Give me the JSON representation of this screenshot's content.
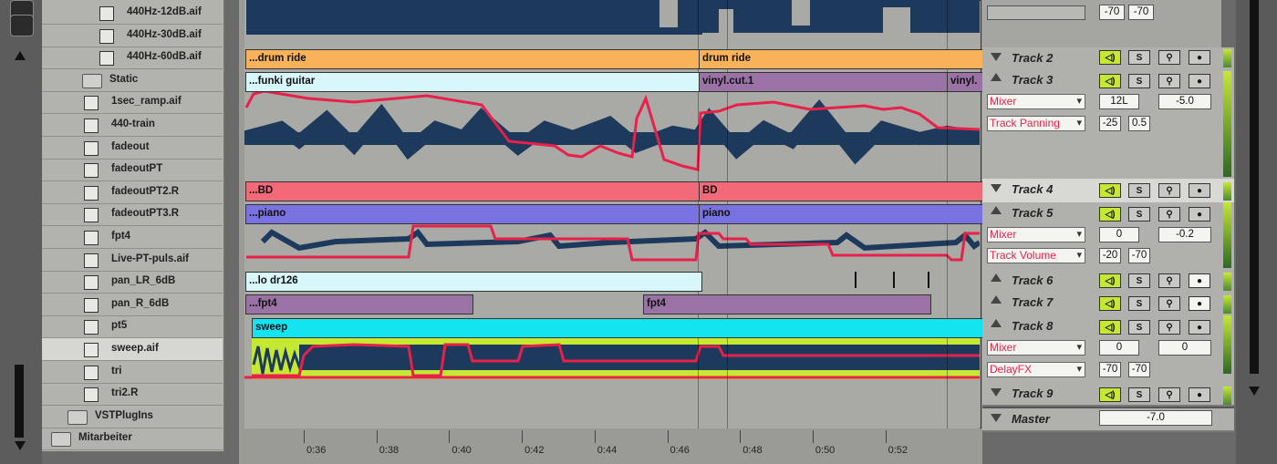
{
  "browser": {
    "items": [
      {
        "label": "440Hz-12dB.aif",
        "type": "file"
      },
      {
        "label": "440Hz-30dB.aif",
        "type": "file"
      },
      {
        "label": "440Hz-60dB.aif",
        "type": "file"
      },
      {
        "label": "Static",
        "type": "folder"
      },
      {
        "label": "1sec_ramp.aif",
        "type": "file"
      },
      {
        "label": "440-train",
        "type": "file"
      },
      {
        "label": "fadeout",
        "type": "file"
      },
      {
        "label": "fadeoutPT",
        "type": "file"
      },
      {
        "label": "fadeoutPT2.R",
        "type": "file"
      },
      {
        "label": "fadeoutPT3.R",
        "type": "file"
      },
      {
        "label": "fpt4",
        "type": "file"
      },
      {
        "label": "Live-PT-puls.aif",
        "type": "file"
      },
      {
        "label": "pan_LR_6dB",
        "type": "file"
      },
      {
        "label": "pan_R_6dB",
        "type": "file"
      },
      {
        "label": "pt5",
        "type": "file"
      },
      {
        "label": "sweep.aif",
        "type": "file"
      },
      {
        "label": "tri",
        "type": "file"
      },
      {
        "label": "tri2.R",
        "type": "file"
      },
      {
        "label": "VSTPlugIns",
        "type": "folder"
      },
      {
        "label": "Mitarbeiter",
        "type": "folder"
      }
    ],
    "selected": "sweep.aif"
  },
  "clips": {
    "drum_ride_a": "...drum ride",
    "drum_ride_b": "drum ride",
    "funki_guitar": "...funki guitar",
    "vinyl_cut": "vinyl.cut.1",
    "vinyl_short": "vinyl.",
    "bd_a": "...BD",
    "bd_b": "BD",
    "piano_a": "...piano",
    "piano_b": "piano",
    "lo_dr": "...lo dr126",
    "fpt4_a": "...fpt4",
    "fpt4_b": "fpt4",
    "sweep": "sweep"
  },
  "timeline": {
    "ticks": [
      "0:36",
      "0:38",
      "0:40",
      "0:42",
      "0:44",
      "0:46",
      "0:48",
      "0:50",
      "0:52"
    ]
  },
  "tracks": {
    "track1": {
      "num_a": "-70",
      "num_b": "-70"
    },
    "track2": {
      "name": "Track 2"
    },
    "track3": {
      "name": "Track 3",
      "dd1": "Mixer",
      "dd2": "Track Panning",
      "v1": "12L",
      "v2": "-5.0",
      "v3": "-25",
      "v4": "0.5"
    },
    "track4": {
      "name": "Track 4"
    },
    "track5": {
      "name": "Track 5",
      "dd1": "Mixer",
      "dd2": "Track Volume",
      "v1": "0",
      "v2": "-0.2",
      "v3": "-20",
      "v4": "-70"
    },
    "track6": {
      "name": "Track 6"
    },
    "track7": {
      "name": "Track 7"
    },
    "track8": {
      "name": "Track 8",
      "dd1": "Mixer",
      "dd2": "DelayFX",
      "v1": "0",
      "v2": "0",
      "v3": "-70",
      "v4": "-70"
    },
    "track9": {
      "name": "Track 9"
    },
    "master": {
      "name": "Master",
      "value": "-7.0"
    }
  },
  "buttons": {
    "solo": "S",
    "speaker": "◁)",
    "arm": "●",
    "mic": "⚲"
  },
  "colors": {
    "drum": "#f7b25a",
    "guitar": "#d8f7fb",
    "vinyl": "#9a72a6",
    "bd": "#f26a78",
    "piano": "#7a72e0",
    "lodr": "#d8f7fb",
    "fpt4": "#9a72a6",
    "sweep": "#14e3f0",
    "automation": "#e8204a",
    "wave": "#1d3a5c",
    "lime": "#c5e832"
  }
}
